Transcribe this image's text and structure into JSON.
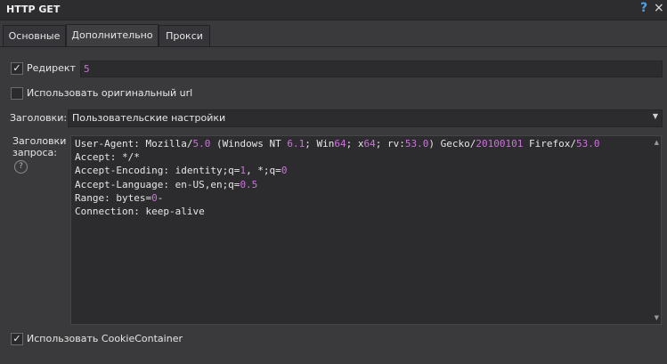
{
  "window": {
    "title": "HTTP GET",
    "help_icon": "?",
    "close_icon": "×"
  },
  "tabs": [
    {
      "label": "Основные"
    },
    {
      "label": "Дополнительно",
      "active": true
    },
    {
      "label": "Прокси"
    }
  ],
  "redirect": {
    "label": "Редирект",
    "checked": true,
    "value": "5"
  },
  "original_url": {
    "label": "Использовать оригинальный url",
    "checked": false
  },
  "headers_select": {
    "label": "Заголовки:",
    "value": "Пользовательские настройки"
  },
  "request_headers": {
    "label_line1": "Заголовки",
    "label_line2": "запроса:",
    "lines": [
      "User-Agent: Mozilla/5.0 (Windows NT 6.1; Win64; x64; rv:53.0) Gecko/20100101 Firefox/53.0",
      "Accept: */*",
      "Accept-Encoding: identity;q=1, *;q=0",
      "Accept-Language: en-US,en;q=0.5",
      "Range: bytes=0-",
      "Connection: keep-alive"
    ]
  },
  "cookie_container": {
    "label": "Использовать CookieContainer",
    "checked": true
  },
  "colors": {
    "number_highlight": "#d070e0",
    "help_blue": "#4aa3e8"
  }
}
